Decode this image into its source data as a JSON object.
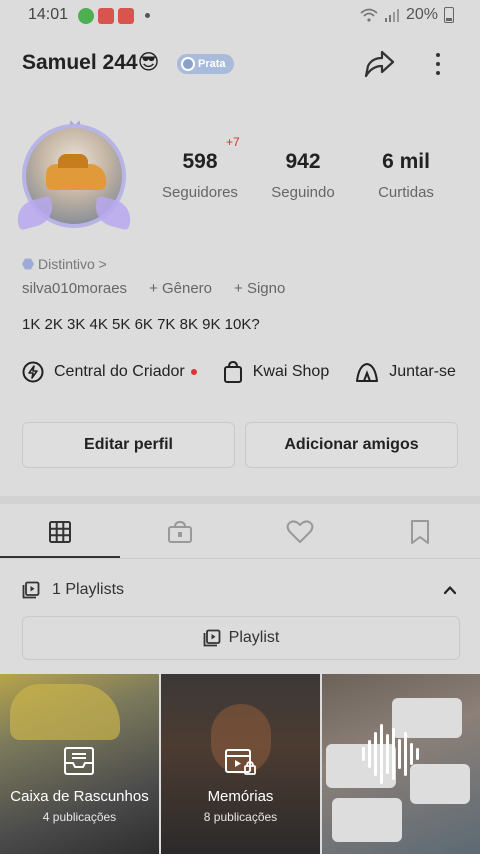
{
  "status_bar": {
    "time": "14:01",
    "battery": "20%"
  },
  "profile": {
    "username": "Samuel 244😎",
    "badge": "Prata",
    "stats": [
      {
        "value": "598",
        "label": "Seguidores"
      },
      {
        "value": "942",
        "label": "Seguindo"
      },
      {
        "value": "6 mil",
        "label": "Curtidas"
      }
    ],
    "followers_new": "+7",
    "distintivo": "Distintivo >",
    "handle": "silva010moraes",
    "gender_link": "+ Gênero",
    "sign_link": "+ Signo",
    "bio": "1K 2K 3K 4K 5K 6K 7K 8K 9K 10K?"
  },
  "links": {
    "creator_center": "Central do Criador",
    "kwai_shop": "Kwai Shop",
    "join": "Juntar-se"
  },
  "buttons": {
    "edit_profile": "Editar perfil",
    "add_friends": "Adicionar amigos"
  },
  "tabs": [
    {
      "icon": "grid-icon",
      "active": true
    },
    {
      "icon": "lock-bag-icon",
      "active": false
    },
    {
      "icon": "heart-icon",
      "active": false
    },
    {
      "icon": "bookmark-icon",
      "active": false
    }
  ],
  "playlists": {
    "count_label": "1 Playlists",
    "button_label": "Playlist"
  },
  "grid": [
    {
      "title": "Caixa de Rascunhos",
      "subtitle": "4 publicações"
    },
    {
      "title": "Memórias",
      "subtitle": "8 publicações"
    },
    {
      "title": "",
      "subtitle": ""
    }
  ],
  "colors": {
    "background": "#dcdcdc",
    "accent_red": "#e0323a",
    "badge": "#a9bbdb"
  }
}
